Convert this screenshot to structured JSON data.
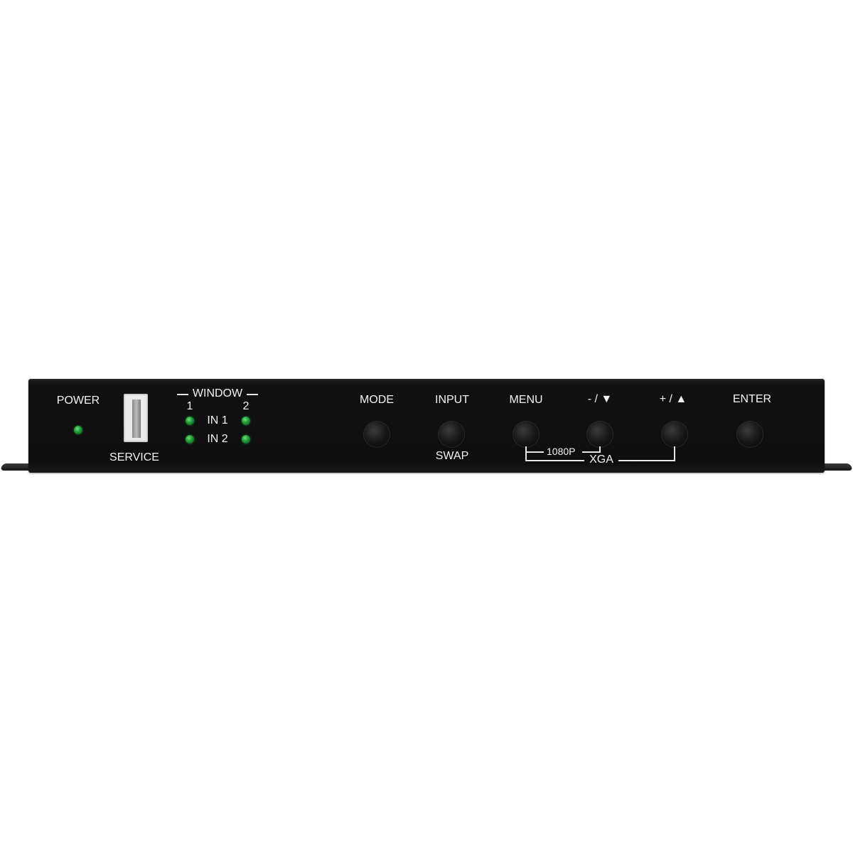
{
  "panel": {
    "power_label": "POWER",
    "service_label": "SERVICE",
    "window": {
      "label": "WINDOW",
      "col1": "1",
      "col2": "2",
      "row1": "IN 1",
      "row2": "IN 2"
    },
    "buttons": {
      "mode": "MODE",
      "input": "INPUT",
      "swap": "SWAP",
      "menu": "MENU",
      "minus": "- / ▼",
      "plus": "+ / ▲",
      "enter": "ENTER"
    },
    "combos": {
      "c1080p": "1080P",
      "xga": "XGA"
    }
  },
  "colors": {
    "led": "#1c9a33",
    "panel": "#111111",
    "text": "#f2f2f2"
  }
}
